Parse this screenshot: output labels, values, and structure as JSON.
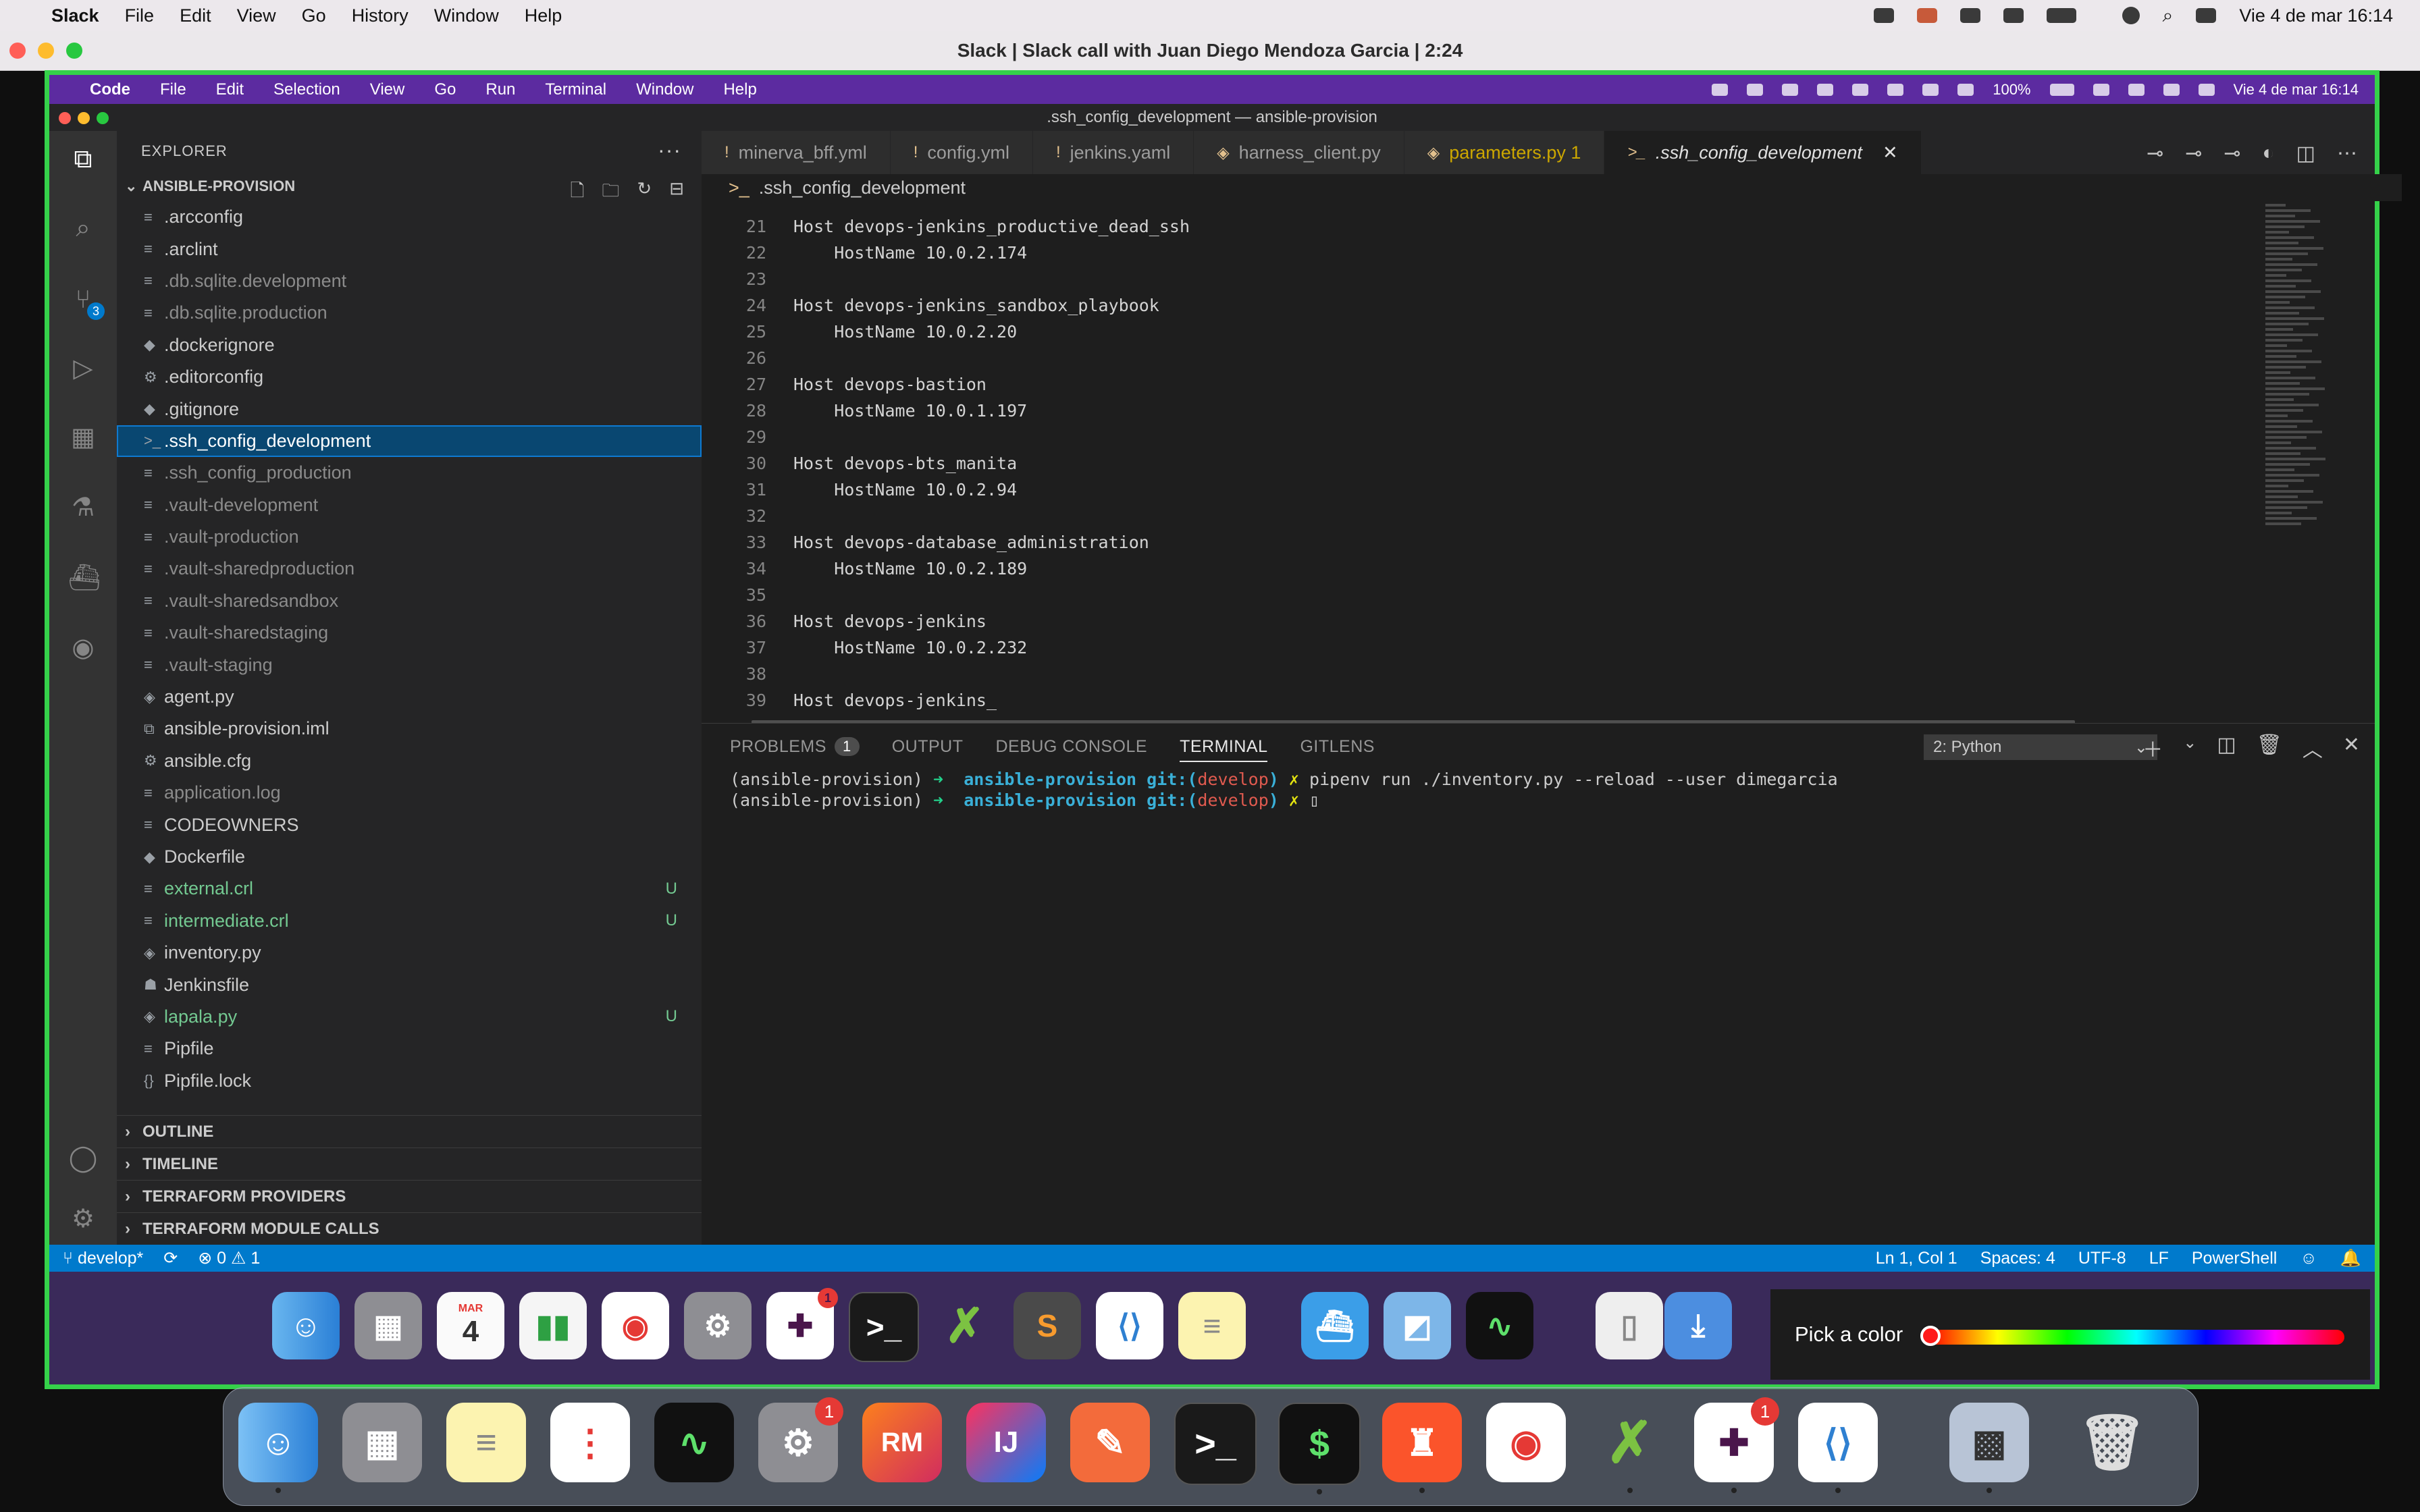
{
  "outer_menubar": {
    "app_name": "Slack",
    "menus": [
      "File",
      "Edit",
      "View",
      "Go",
      "History",
      "Window",
      "Help"
    ],
    "clock": "Vie 4 de mar  16:14"
  },
  "slack_window": {
    "title": "Slack | Slack call with Juan Diego Mendoza Garcia | 2:24"
  },
  "inner_menubar": {
    "app_name": "Code",
    "menus": [
      "File",
      "Edit",
      "Selection",
      "View",
      "Go",
      "Run",
      "Terminal",
      "Window",
      "Help"
    ],
    "battery": "100%",
    "clock": "Vie 4 de mar  16:14"
  },
  "vscode": {
    "window_title": ".ssh_config_development — ansible-provision",
    "activity_badge": "3",
    "explorer": {
      "header": "EXPLORER",
      "more": "···",
      "folder": "ANSIBLE-PROVISION",
      "files": [
        {
          "name": ".arcconfig",
          "icon": "≡",
          "state": "normal"
        },
        {
          "name": ".arclint",
          "icon": "≡",
          "state": "normal"
        },
        {
          "name": ".db.sqlite.development",
          "icon": "≡",
          "state": "muted"
        },
        {
          "name": ".db.sqlite.production",
          "icon": "≡",
          "state": "muted"
        },
        {
          "name": ".dockerignore",
          "icon": "◆",
          "state": "normal"
        },
        {
          "name": ".editorconfig",
          "icon": "⚙",
          "state": "normal"
        },
        {
          "name": ".gitignore",
          "icon": "◆",
          "state": "normal"
        },
        {
          "name": ".ssh_config_development",
          "icon": ">_",
          "state": "selected"
        },
        {
          "name": ".ssh_config_production",
          "icon": "≡",
          "state": "muted"
        },
        {
          "name": ".vault-development",
          "icon": "≡",
          "state": "muted"
        },
        {
          "name": ".vault-production",
          "icon": "≡",
          "state": "muted"
        },
        {
          "name": ".vault-sharedproduction",
          "icon": "≡",
          "state": "muted"
        },
        {
          "name": ".vault-sharedsandbox",
          "icon": "≡",
          "state": "muted"
        },
        {
          "name": ".vault-sharedstaging",
          "icon": "≡",
          "state": "muted"
        },
        {
          "name": ".vault-staging",
          "icon": "≡",
          "state": "muted"
        },
        {
          "name": "agent.py",
          "icon": "◈",
          "state": "normal"
        },
        {
          "name": "ansible-provision.iml",
          "icon": "⧉",
          "state": "normal"
        },
        {
          "name": "ansible.cfg",
          "icon": "⚙",
          "state": "normal"
        },
        {
          "name": "application.log",
          "icon": "≡",
          "state": "muted"
        },
        {
          "name": "CODEOWNERS",
          "icon": "≡",
          "state": "normal"
        },
        {
          "name": "Dockerfile",
          "icon": "◆",
          "state": "normal"
        },
        {
          "name": "external.crl",
          "icon": "≡",
          "state": "untracked",
          "badge": "U"
        },
        {
          "name": "intermediate.crl",
          "icon": "≡",
          "state": "untracked",
          "badge": "U"
        },
        {
          "name": "inventory.py",
          "icon": "◈",
          "state": "normal"
        },
        {
          "name": "Jenkinsfile",
          "icon": "☗",
          "state": "normal"
        },
        {
          "name": "lapala.py",
          "icon": "◈",
          "state": "untracked",
          "badge": "U"
        },
        {
          "name": "Pipfile",
          "icon": "≡",
          "state": "normal"
        },
        {
          "name": "Pipfile.lock",
          "icon": "{}",
          "state": "normal"
        }
      ],
      "sections": [
        "OUTLINE",
        "TIMELINE",
        "TERRAFORM PROVIDERS",
        "TERRAFORM MODULE CALLS"
      ]
    },
    "tabs": [
      {
        "label": "minerva_bff.yml",
        "icon": "!"
      },
      {
        "label": "config.yml",
        "icon": "!"
      },
      {
        "label": "jenkins.yaml",
        "icon": "!"
      },
      {
        "label": "harness_client.py",
        "icon": "◈"
      },
      {
        "label": "parameters.py 1",
        "icon": "◈"
      },
      {
        "label": ".ssh_config_development",
        "icon": ">_"
      }
    ],
    "breadcrumb": ".ssh_config_development",
    "code_lines": [
      {
        "n": "21",
        "text": "Host devops-jenkins_productive_dead_ssh"
      },
      {
        "n": "22",
        "text": "    HostName 10.0.2.174"
      },
      {
        "n": "23",
        "text": ""
      },
      {
        "n": "24",
        "text": "Host devops-jenkins_sandbox_playbook"
      },
      {
        "n": "25",
        "text": "    HostName 10.0.2.20"
      },
      {
        "n": "26",
        "text": ""
      },
      {
        "n": "27",
        "text": "Host devops-bastion"
      },
      {
        "n": "28",
        "text": "    HostName 10.0.1.197"
      },
      {
        "n": "29",
        "text": ""
      },
      {
        "n": "30",
        "text": "Host devops-bts_manita"
      },
      {
        "n": "31",
        "text": "    HostName 10.0.2.94"
      },
      {
        "n": "32",
        "text": ""
      },
      {
        "n": "33",
        "text": "Host devops-database_administration"
      },
      {
        "n": "34",
        "text": "    HostName 10.0.2.189"
      },
      {
        "n": "35",
        "text": ""
      },
      {
        "n": "36",
        "text": "Host devops-jenkins"
      },
      {
        "n": "37",
        "text": "    HostName 10.0.2.232"
      },
      {
        "n": "38",
        "text": ""
      },
      {
        "n": "39",
        "text": "Host devops-jenkins_"
      }
    ],
    "panel": {
      "tabs": [
        "PROBLEMS",
        "OUTPUT",
        "DEBUG CONSOLE",
        "TERMINAL",
        "GITLENS"
      ],
      "problems_count": "1",
      "terminal_select": "2: Python",
      "terminal_lines": [
        {
          "env": "(ansible-provision)",
          "arrow": "➜",
          "dir": "ansible-provision",
          "git": "git:(",
          "branch": "develop",
          "close": ")",
          "mark": "✗",
          "cmd": "pipenv run ./inventory.py --reload --user dimegarcia"
        },
        {
          "env": "(ansible-provision)",
          "arrow": "➜",
          "dir": "ansible-provision",
          "git": "git:(",
          "branch": "develop",
          "close": ")",
          "mark": "✗",
          "cmd": "▯"
        }
      ]
    },
    "statusbar": {
      "branch": "develop*",
      "sync": "⟳",
      "errors": "⊗ 0 ⚠ 1",
      "position": "Ln 1, Col 1",
      "spaces": "Spaces: 4",
      "encoding": "UTF-8",
      "eol": "LF",
      "language": "PowerShell"
    }
  },
  "color_picker": {
    "label": "Pick a color"
  },
  "inner_dock": {
    "calendar_month": "MAR",
    "calendar_day": "4",
    "slack_badge": "1"
  },
  "outer_dock": {
    "settings_badge": "1",
    "slack_badge": "1",
    "rubymine_label": "RM",
    "intellij_label": "IJ"
  }
}
